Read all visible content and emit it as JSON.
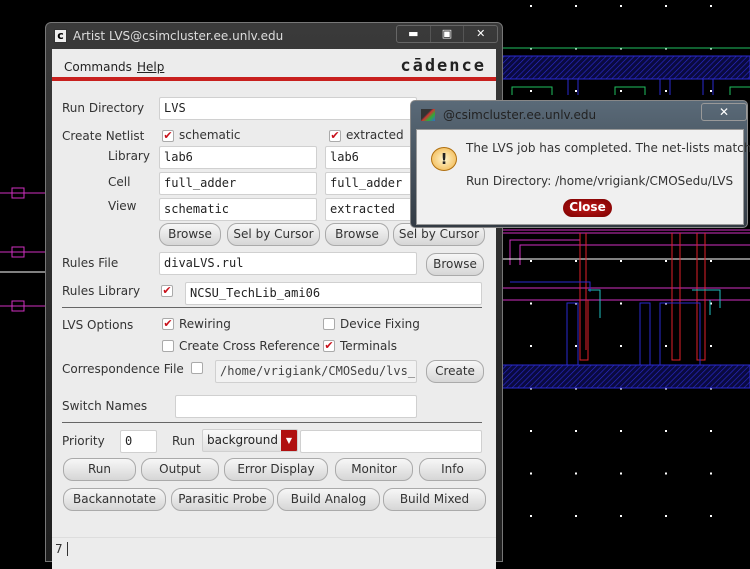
{
  "background": {
    "layer_colors": {
      "metal1": "#1a1ad0",
      "poly": "#e0202a",
      "metal2": "#d030c0",
      "active": "#20c060",
      "grid": "#ffffff"
    }
  },
  "window": {
    "title": "Artist LVS@csimcluster.ee.unlv.edu",
    "icon": "cadence-app-icon",
    "controls": {
      "minimize": "▬",
      "maximize": "▣",
      "close": "✕"
    }
  },
  "menu": {
    "items": [
      "Commands",
      "Help"
    ],
    "logo": "cādence"
  },
  "form": {
    "run_directory": {
      "label": "Run Directory",
      "value": "LVS"
    },
    "create_netlist": {
      "label": "Create Netlist",
      "schematic": {
        "label": "schematic",
        "checked": true
      },
      "extracted": {
        "label": "extracted",
        "checked": true
      }
    },
    "library": {
      "label": "Library",
      "schematic": "lab6",
      "extracted": "lab6"
    },
    "cell": {
      "label": "Cell",
      "schematic": "full_adder",
      "extracted": "full_adder"
    },
    "view": {
      "label": "View",
      "schematic": "schematic",
      "extracted": "extracted"
    },
    "browse": "Browse",
    "sel_by_cursor": "Sel by Cursor",
    "rules_file": {
      "label": "Rules File",
      "value": "divaLVS.rul",
      "button": "Browse"
    },
    "rules_library": {
      "label": "Rules Library",
      "checked": true,
      "value": "NCSU_TechLib_ami06"
    },
    "lvs_options": {
      "label": "LVS Options",
      "rewiring": {
        "label": "Rewiring",
        "checked": true
      },
      "device_fixing": {
        "label": "Device Fixing",
        "checked": false
      },
      "cross_reference": {
        "label": "Create Cross Reference",
        "checked": false
      },
      "terminals": {
        "label": "Terminals",
        "checked": true
      }
    },
    "correspondence_file": {
      "label": "Correspondence File",
      "checked": false,
      "value": "/home/vrigiank/CMOSedu/lvs_c",
      "button": "Create"
    },
    "switch_names": {
      "label": "Switch Names",
      "value": ""
    },
    "priority": {
      "label": "Priority",
      "value": "0"
    },
    "run": {
      "label": "Run",
      "selected": "background",
      "extra": ""
    },
    "buttons_row1": [
      "Run",
      "Output",
      "Error Display",
      "Monitor",
      "Info"
    ],
    "buttons_row2": [
      "Backannotate",
      "Parasitic Probe",
      "Build Analog",
      "Build Mixed"
    ]
  },
  "status": {
    "text": "7"
  },
  "dialog": {
    "title": "@csimcluster.ee.unlv.edu",
    "close_x": "✕",
    "message": "The LVS job has completed. The net-lists match.",
    "run_directory": "Run Directory: /home/vrigiank/CMOSedu/LVS",
    "close_button": "Close",
    "icon": "warning-speech-bubble-icon"
  }
}
